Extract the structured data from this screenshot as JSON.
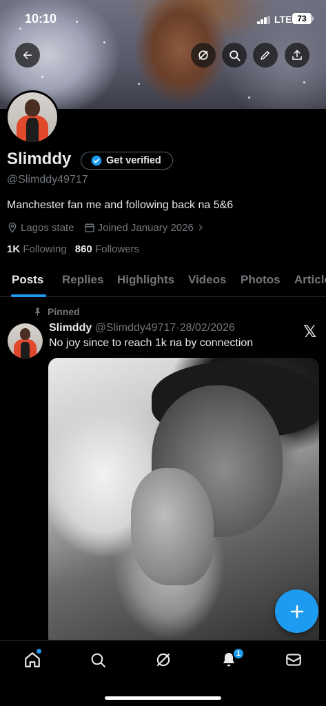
{
  "status_bar": {
    "time": "10:10",
    "network": "LTE",
    "battery": "73"
  },
  "header": {
    "back_icon": "arrow-left-icon",
    "grok_icon": "grok-icon",
    "search_icon": "search-icon",
    "edit_icon": "pencil-icon",
    "share_icon": "share-icon"
  },
  "profile": {
    "name": "Slimddy",
    "verify_label": "Get verified",
    "handle": "@Slimddy49717",
    "bio": "Manchester fan me and following back na 5&6",
    "location": "Lagos state",
    "joined": "Joined January 2026",
    "following_count": "1K",
    "following_label": "Following",
    "followers_count": "860",
    "followers_label": "Followers"
  },
  "tabs": [
    "Posts",
    "Replies",
    "Highlights",
    "Videos",
    "Photos",
    "Articles"
  ],
  "pinned_post": {
    "pinned_label": "Pinned",
    "author": "Slimddy",
    "handle": "@Slimddy49717",
    "separator": "·",
    "date": "28/02/2026",
    "text": "No joy since to reach 1k na by connection",
    "source_icon": "x-logo-icon"
  },
  "bottom_nav": {
    "items": [
      "home-icon",
      "search-icon",
      "grok-icon",
      "notifications-icon",
      "messages-icon"
    ],
    "notification_count": "1"
  },
  "colors": {
    "accent": "#1d9bf0",
    "background": "#000000",
    "muted": "#71767b",
    "text": "#e7e9ea"
  }
}
